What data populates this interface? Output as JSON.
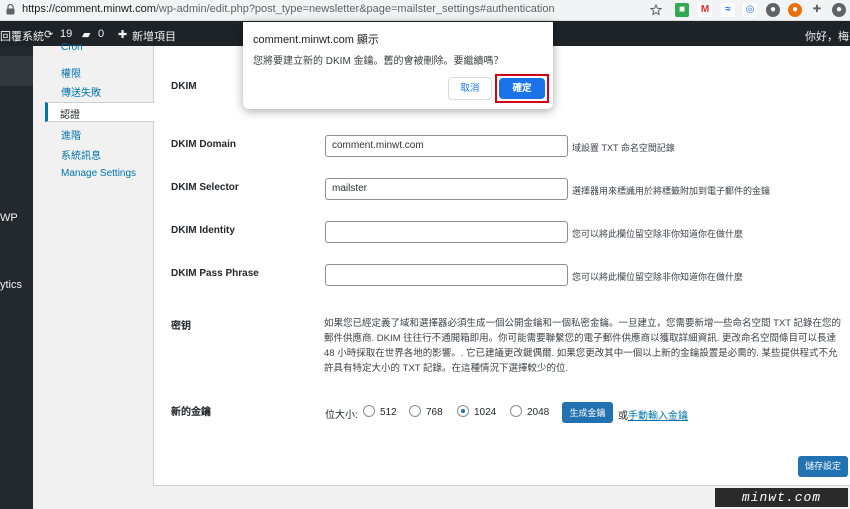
{
  "browser": {
    "url_host": "https://comment.minwt.com",
    "url_path": "/wp-admin/edit.php?post_type=newsletter&page=mailster_settings#authentication"
  },
  "adminbar": {
    "site": "回覆系統",
    "updates": "19",
    "comments": "0",
    "new": "新增項目",
    "greeting": "你好，梅干"
  },
  "sidebar": {
    "item_wp": "WP",
    "item_analytics": "ytics"
  },
  "tabs": [
    {
      "label": "Cron"
    },
    {
      "label": "權限"
    },
    {
      "label": "傳送失敗"
    },
    {
      "label": "認證"
    },
    {
      "label": "進階"
    },
    {
      "label": "系統訊息"
    },
    {
      "label": "Manage Settings"
    }
  ],
  "form": {
    "dkim_label": "DKIM",
    "domain": {
      "label": "DKIM Domain",
      "value": "comment.minwt.com",
      "desc": "域設置 TXT 命名空間記錄"
    },
    "selector": {
      "label": "DKIM Selector",
      "value": "mailster",
      "desc": "選擇器用來標識用於將標籤附加到電子郵件的金鑰"
    },
    "identity": {
      "label": "DKIM Identity",
      "value": "",
      "desc": "您可以將此欄位留空除非你知道你在做什麼"
    },
    "passphrase": {
      "label": "DKIM Pass Phrase",
      "value": "",
      "desc": "您可以將此欄位留空除非你知道你在做什麼"
    },
    "key_label": "密钥",
    "key_desc": "如果您已經定義了域和選擇器必須生成一個公開金鑰和一個私密金鑰。一旦建立，您需要新增一些命名空間 TXT 記錄在您的郵件供應商. DKIM 往往行不通開箱即用。你可能需要聯繫您的電子郵件供應商以獲取詳細資訊. 更改命名空間條目可以長達 48 小時採取在世界各地的影響。. 它已建議更改鍵偶爾. 如果您更改其中一個以上新的金鑰設置是必需的. 某些提供程式不允許具有特定大小的 TXT 記錄。在這種情況下選擇較少的位.",
    "newkey_label": "新的金鑰",
    "bits_label": "位大小:",
    "bits_options": [
      "512",
      "768",
      "1024",
      "2048"
    ],
    "bits_selected": "1024",
    "generate_label": "生成金鑰",
    "or_label": "或",
    "manual_label": "手動輸入金鑰",
    "save_label": "儲存設定"
  },
  "dialog": {
    "title": "comment.minwt.com 顯示",
    "message": "您將要建立新的 DKIM 金鑰。舊的會被刪除。要繼續嗎？",
    "cancel": "取消",
    "ok": "確定"
  },
  "watermark": "minwt.com",
  "colors": {
    "wp_blue": "#2271b1",
    "chrome_blue": "#1a73e8",
    "highlight_red": "#d0021b"
  }
}
